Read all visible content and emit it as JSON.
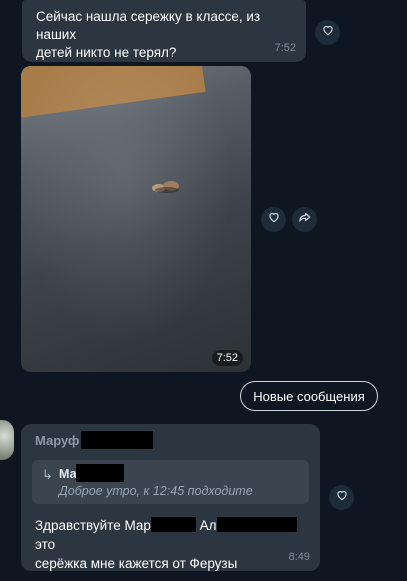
{
  "messages": [
    {
      "text": "Сейчас нашла сережку в классе, из наших\nдетей никто не терял?",
      "time": "7:52"
    },
    {
      "type": "photo",
      "time": "7:52"
    }
  ],
  "new_messages_label": "Новые сообщения",
  "incoming": {
    "sender": "Маруф",
    "reply": {
      "name": "Ма",
      "text": "Доброе утро, к 12:45 подходите"
    },
    "text_part1": "Здравствуйте Мар",
    "text_part2": "Ал",
    "text_part3": "это",
    "text_line2": "серёжка мне кажется от Ферузы",
    "time": "8:49"
  },
  "icons": {
    "react": "heart-icon",
    "forward": "forward-icon",
    "reply": "reply-arrow-icon"
  },
  "colors": {
    "background": "#0e1621",
    "bubble": "#2b3640",
    "accent_text": "#8e99a5"
  }
}
